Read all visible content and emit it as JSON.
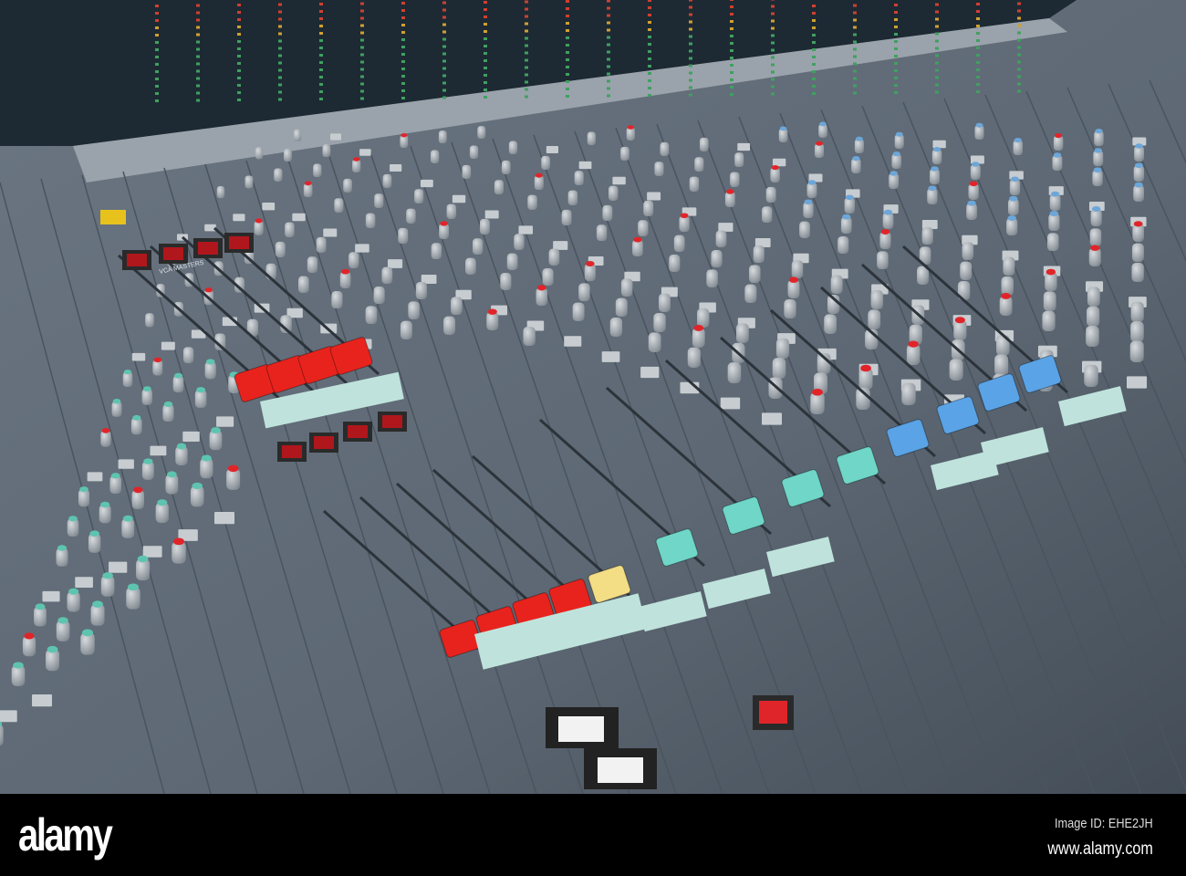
{
  "photo": {
    "subject": "mixing-console",
    "console_label": "VCA MASTERS",
    "colors": {
      "surface": "#5d6874",
      "meter_bridge": "#1d2a33",
      "knob": "#a9b0b6",
      "knob_cap_red": "#e0252a",
      "knob_cap_blue": "#6da6d8",
      "knob_cap_teal": "#5ec4b0",
      "fader_red": "#e8231d",
      "fader_yellow": "#f3de86",
      "fader_teal": "#6fd6c8",
      "fader_blue": "#5aa3e6",
      "scribble_strip": "#bfe3dc"
    }
  },
  "watermark": {
    "logo": "alamy",
    "image_id": "Image ID: EHE2JH",
    "url": "www.alamy.com"
  }
}
